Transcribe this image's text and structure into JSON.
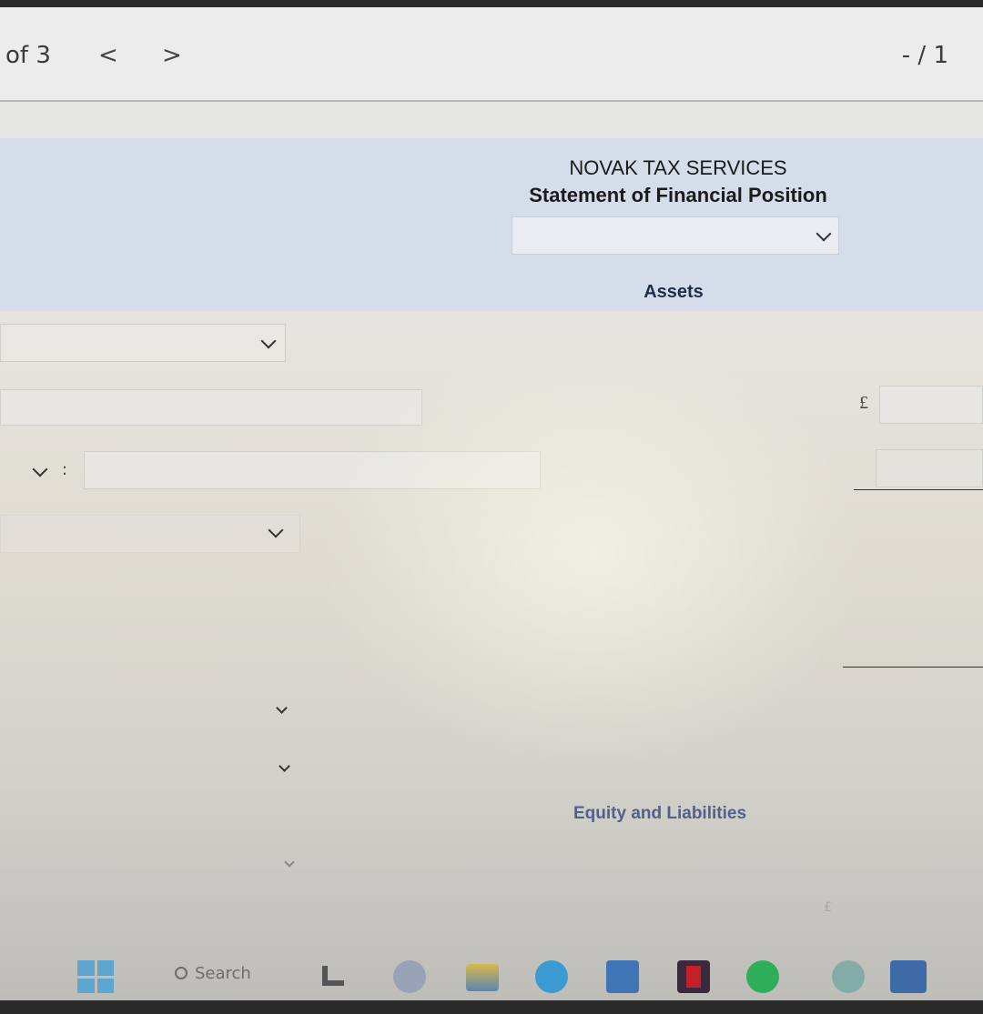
{
  "toolbar": {
    "page_count": "of 3",
    "prev_label": "<",
    "next_label": ">",
    "page_indicator": "- / 1"
  },
  "statement": {
    "company_name": "NOVAK TAX SERVICES",
    "title": "Statement of Financial Position",
    "date_select_value": "",
    "assets_heading": "Assets",
    "currency_symbol": "£",
    "colon": ":",
    "equity_heading": "Equity and Liabilities"
  },
  "taskbar": {
    "search_placeholder": "Search",
    "icons": [
      "windows-start-icon",
      "search-icon",
      "app-l-icon",
      "chat-icon",
      "file-explorer-icon",
      "edge-icon",
      "store-icon",
      "netflix-icon",
      "spotify-icon",
      "teams-icon",
      "word-icon"
    ]
  },
  "colors": {
    "header_band": "#d5dcea",
    "heading_text": "#1f2f4a",
    "equity_text": "#53608a"
  }
}
